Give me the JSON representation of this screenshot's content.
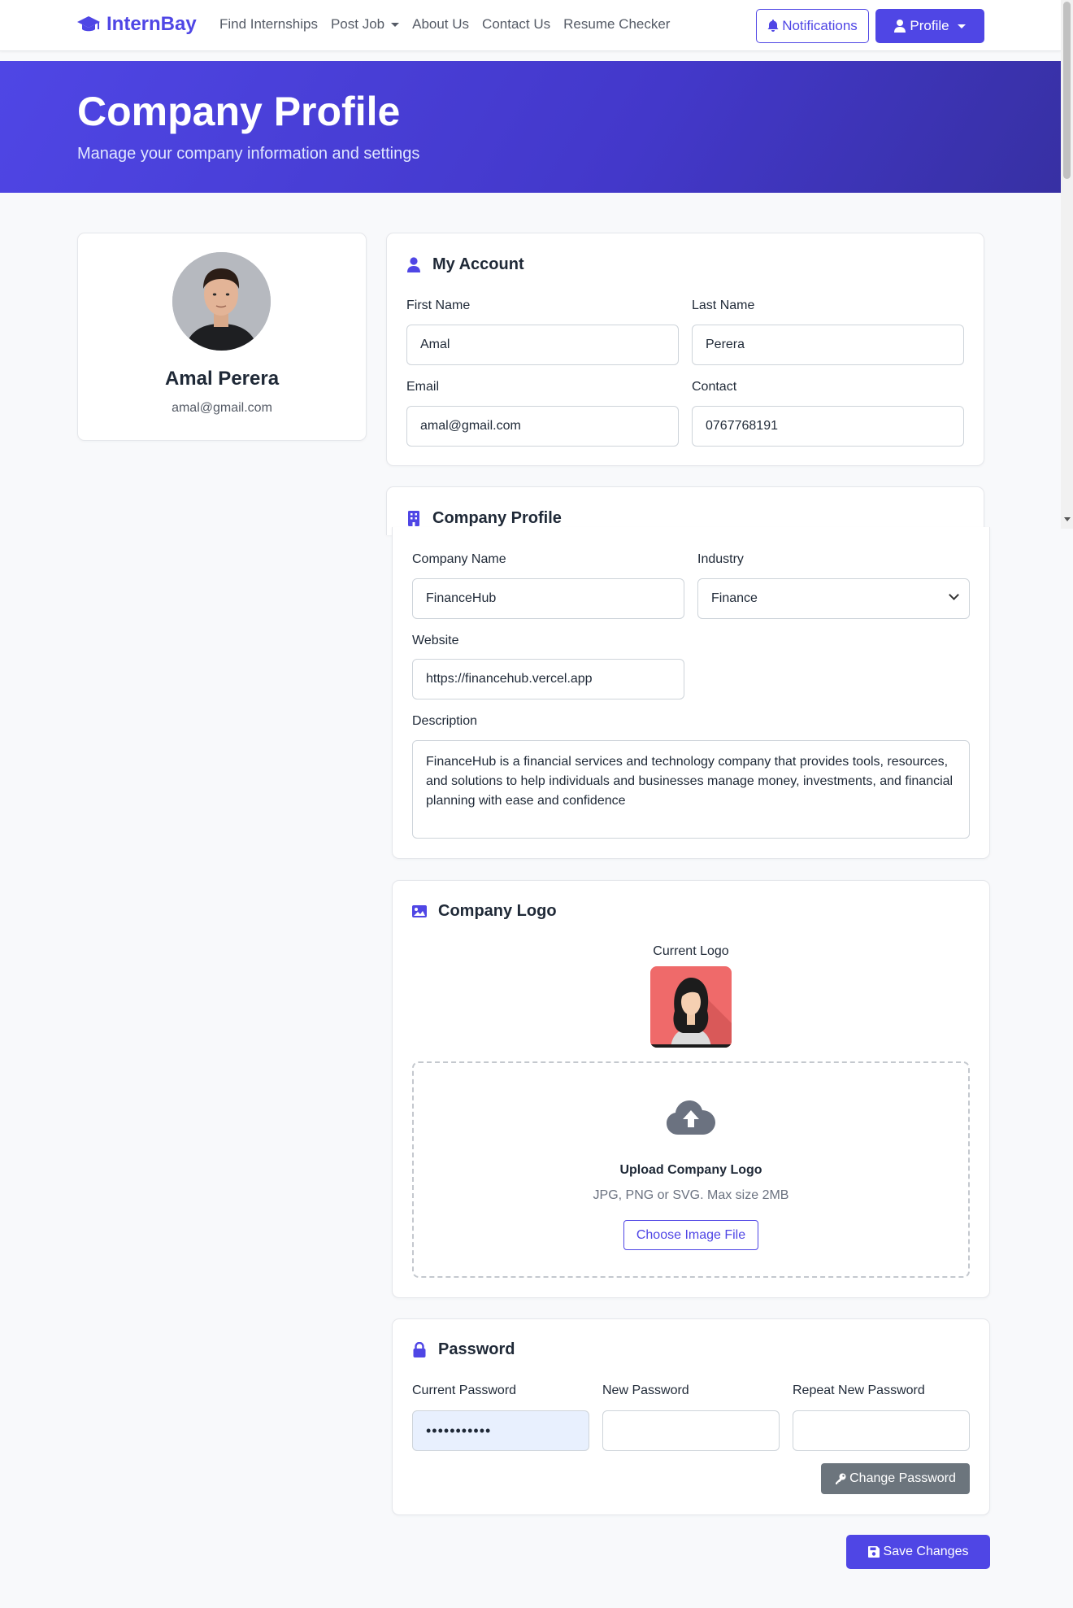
{
  "navbar": {
    "brand": "InternBay",
    "links": [
      "Find Internships",
      "Post Job",
      "About Us",
      "Contact Us",
      "Resume Checker"
    ],
    "notifications_label": "Notifications",
    "profile_label": "Profile"
  },
  "hero": {
    "title": "Company Profile",
    "subtitle": "Manage your company information and settings"
  },
  "profile_card": {
    "name": "Amal Perera",
    "email": "amal@gmail.com"
  },
  "account": {
    "title": "My Account",
    "first_name_label": "First Name",
    "first_name_value": "Amal",
    "last_name_label": "Last Name",
    "last_name_value": "Perera",
    "email_label": "Email",
    "email_value": "amal@gmail.com",
    "contact_label": "Contact",
    "contact_value": "0767768191"
  },
  "company": {
    "title": "Company Profile",
    "name_label": "Company Name",
    "name_value": "FinanceHub",
    "industry_label": "Industry",
    "industry_value": "Finance",
    "website_label": "Website",
    "website_value": "https://financehub.vercel.app",
    "description_label": "Description",
    "description_value": "FinanceHub is a financial services and technology company that provides tools, resources, and solutions to help individuals and businesses manage money, investments, and financial planning with ease and confidence"
  },
  "logo": {
    "title": "Company Logo",
    "current_label": "Current Logo",
    "upload_title": "Upload Company Logo",
    "upload_hint": "JPG, PNG or SVG. Max size 2MB",
    "choose_label": "Choose Image File"
  },
  "password": {
    "title": "Password",
    "current_label": "Current Password",
    "current_value": "•••••••••••",
    "new_label": "New Password",
    "repeat_label": "Repeat New Password",
    "change_label": "Change Password"
  },
  "save_label": "Save Changes",
  "colors": {
    "primary": "#4f46e5",
    "secondary": "#6c757d",
    "autofill": "#e8f0fe"
  }
}
